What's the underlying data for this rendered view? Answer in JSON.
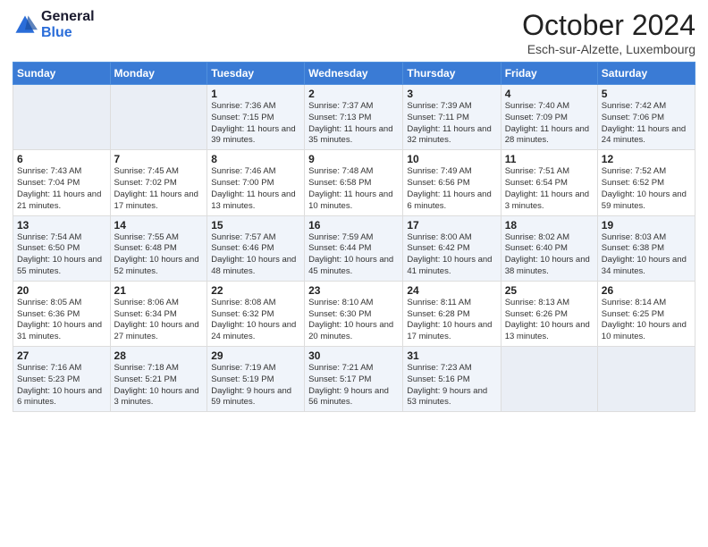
{
  "logo": {
    "general": "General",
    "blue": "Blue"
  },
  "title": {
    "month": "October 2024",
    "location": "Esch-sur-Alzette, Luxembourg"
  },
  "headers": [
    "Sunday",
    "Monday",
    "Tuesday",
    "Wednesday",
    "Thursday",
    "Friday",
    "Saturday"
  ],
  "weeks": [
    [
      {
        "day": "",
        "info": ""
      },
      {
        "day": "",
        "info": ""
      },
      {
        "day": "1",
        "info": "Sunrise: 7:36 AM\nSunset: 7:15 PM\nDaylight: 11 hours and 39 minutes."
      },
      {
        "day": "2",
        "info": "Sunrise: 7:37 AM\nSunset: 7:13 PM\nDaylight: 11 hours and 35 minutes."
      },
      {
        "day": "3",
        "info": "Sunrise: 7:39 AM\nSunset: 7:11 PM\nDaylight: 11 hours and 32 minutes."
      },
      {
        "day": "4",
        "info": "Sunrise: 7:40 AM\nSunset: 7:09 PM\nDaylight: 11 hours and 28 minutes."
      },
      {
        "day": "5",
        "info": "Sunrise: 7:42 AM\nSunset: 7:06 PM\nDaylight: 11 hours and 24 minutes."
      }
    ],
    [
      {
        "day": "6",
        "info": "Sunrise: 7:43 AM\nSunset: 7:04 PM\nDaylight: 11 hours and 21 minutes."
      },
      {
        "day": "7",
        "info": "Sunrise: 7:45 AM\nSunset: 7:02 PM\nDaylight: 11 hours and 17 minutes."
      },
      {
        "day": "8",
        "info": "Sunrise: 7:46 AM\nSunset: 7:00 PM\nDaylight: 11 hours and 13 minutes."
      },
      {
        "day": "9",
        "info": "Sunrise: 7:48 AM\nSunset: 6:58 PM\nDaylight: 11 hours and 10 minutes."
      },
      {
        "day": "10",
        "info": "Sunrise: 7:49 AM\nSunset: 6:56 PM\nDaylight: 11 hours and 6 minutes."
      },
      {
        "day": "11",
        "info": "Sunrise: 7:51 AM\nSunset: 6:54 PM\nDaylight: 11 hours and 3 minutes."
      },
      {
        "day": "12",
        "info": "Sunrise: 7:52 AM\nSunset: 6:52 PM\nDaylight: 10 hours and 59 minutes."
      }
    ],
    [
      {
        "day": "13",
        "info": "Sunrise: 7:54 AM\nSunset: 6:50 PM\nDaylight: 10 hours and 55 minutes."
      },
      {
        "day": "14",
        "info": "Sunrise: 7:55 AM\nSunset: 6:48 PM\nDaylight: 10 hours and 52 minutes."
      },
      {
        "day": "15",
        "info": "Sunrise: 7:57 AM\nSunset: 6:46 PM\nDaylight: 10 hours and 48 minutes."
      },
      {
        "day": "16",
        "info": "Sunrise: 7:59 AM\nSunset: 6:44 PM\nDaylight: 10 hours and 45 minutes."
      },
      {
        "day": "17",
        "info": "Sunrise: 8:00 AM\nSunset: 6:42 PM\nDaylight: 10 hours and 41 minutes."
      },
      {
        "day": "18",
        "info": "Sunrise: 8:02 AM\nSunset: 6:40 PM\nDaylight: 10 hours and 38 minutes."
      },
      {
        "day": "19",
        "info": "Sunrise: 8:03 AM\nSunset: 6:38 PM\nDaylight: 10 hours and 34 minutes."
      }
    ],
    [
      {
        "day": "20",
        "info": "Sunrise: 8:05 AM\nSunset: 6:36 PM\nDaylight: 10 hours and 31 minutes."
      },
      {
        "day": "21",
        "info": "Sunrise: 8:06 AM\nSunset: 6:34 PM\nDaylight: 10 hours and 27 minutes."
      },
      {
        "day": "22",
        "info": "Sunrise: 8:08 AM\nSunset: 6:32 PM\nDaylight: 10 hours and 24 minutes."
      },
      {
        "day": "23",
        "info": "Sunrise: 8:10 AM\nSunset: 6:30 PM\nDaylight: 10 hours and 20 minutes."
      },
      {
        "day": "24",
        "info": "Sunrise: 8:11 AM\nSunset: 6:28 PM\nDaylight: 10 hours and 17 minutes."
      },
      {
        "day": "25",
        "info": "Sunrise: 8:13 AM\nSunset: 6:26 PM\nDaylight: 10 hours and 13 minutes."
      },
      {
        "day": "26",
        "info": "Sunrise: 8:14 AM\nSunset: 6:25 PM\nDaylight: 10 hours and 10 minutes."
      }
    ],
    [
      {
        "day": "27",
        "info": "Sunrise: 7:16 AM\nSunset: 5:23 PM\nDaylight: 10 hours and 6 minutes."
      },
      {
        "day": "28",
        "info": "Sunrise: 7:18 AM\nSunset: 5:21 PM\nDaylight: 10 hours and 3 minutes."
      },
      {
        "day": "29",
        "info": "Sunrise: 7:19 AM\nSunset: 5:19 PM\nDaylight: 9 hours and 59 minutes."
      },
      {
        "day": "30",
        "info": "Sunrise: 7:21 AM\nSunset: 5:17 PM\nDaylight: 9 hours and 56 minutes."
      },
      {
        "day": "31",
        "info": "Sunrise: 7:23 AM\nSunset: 5:16 PM\nDaylight: 9 hours and 53 minutes."
      },
      {
        "day": "",
        "info": ""
      },
      {
        "day": "",
        "info": ""
      }
    ]
  ]
}
